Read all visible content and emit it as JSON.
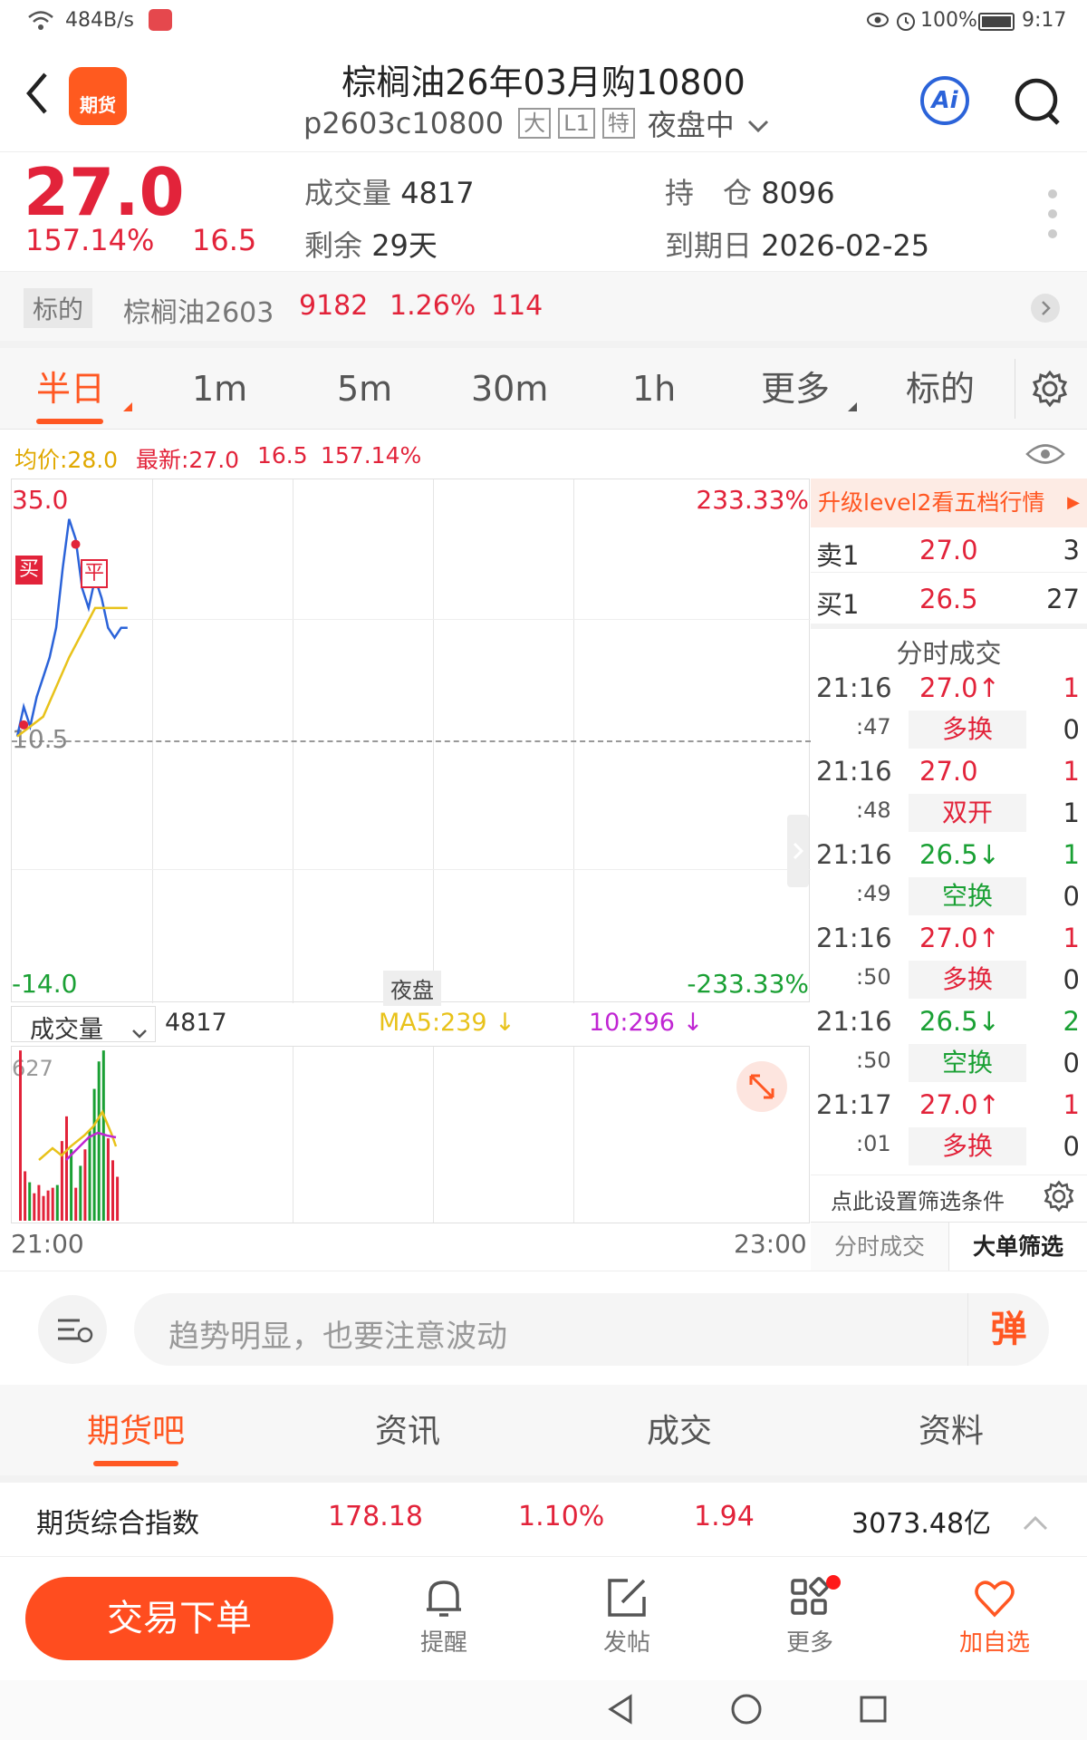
{
  "status_bar": {
    "net_speed": "484B/s",
    "battery": "100%",
    "time": "9:17"
  },
  "header": {
    "logo_text": "期货",
    "title": "棕榈油26年03月购10800",
    "code": "p2603c10800",
    "tags": [
      "大",
      "L1",
      "特"
    ],
    "session": "夜盘中",
    "ai_label": "Ai"
  },
  "summary": {
    "price": "27.0",
    "change_pct": "157.14%",
    "change": "16.5",
    "volume_label": "成交量",
    "volume": "4817",
    "remain_label": "剩余",
    "remain": "29天",
    "oi_label": "持　仓",
    "oi": "8096",
    "expiry_label": "到期日",
    "expiry": "2026-02-25"
  },
  "underlying": {
    "tag": "标的",
    "name": "棕榈油2603",
    "price": "9182",
    "pct": "1.26%",
    "chg": "114"
  },
  "period_tabs": [
    "半日",
    "1m",
    "5m",
    "30m",
    "1h",
    "更多",
    "标的"
  ],
  "info_line": {
    "avg": "均价:28.0",
    "latest": "最新:27.0",
    "chg": "16.5",
    "pct": "157.14%"
  },
  "chart": {
    "y_max": "35.0",
    "y_mid": "10.5",
    "y_min": "-14.0",
    "pct_max": "233.33%",
    "pct_min": "-233.33%",
    "session_label": "夜盘",
    "marker_buy": "买",
    "marker_close": "平",
    "vol_selector": "成交量",
    "vol_value": "4817",
    "ma5": "MA5:239",
    "ma10": "10:296",
    "vol_max": "627",
    "time_start": "21:00",
    "time_end": "23:00"
  },
  "chart_data": {
    "type": "line",
    "series": [
      {
        "name": "最新",
        "x": [
          "21:00",
          "21:01",
          "21:02",
          "21:03",
          "21:04",
          "21:05",
          "21:06",
          "21:07",
          "21:08",
          "21:09",
          "21:10",
          "21:11",
          "21:12",
          "21:13",
          "21:14",
          "21:15",
          "21:16",
          "21:17"
        ],
        "values": [
          11,
          14,
          12,
          15,
          17,
          19,
          22,
          28,
          33,
          31,
          26,
          24,
          27,
          25,
          22,
          21,
          22,
          22
        ]
      },
      {
        "name": "均价",
        "x": [
          "21:00",
          "21:04",
          "21:08",
          "21:12",
          "21:17"
        ],
        "values": [
          11,
          13,
          19,
          24,
          24
        ]
      }
    ],
    "ylim": [
      -14.0,
      35.0
    ]
  },
  "order_book": {
    "upgrade_label": "升级level2看五档行情",
    "ask_label": "卖1",
    "ask_price": "27.0",
    "ask_qty": "3",
    "bid_label": "买1",
    "bid_price": "26.5",
    "bid_qty": "27",
    "ticks_title": "分时成交",
    "ticks": [
      {
        "time": "21:16",
        "sec": ":47",
        "price": "27.0↑",
        "qty": "1",
        "type": "多换",
        "type_qty": "0",
        "dir": "up"
      },
      {
        "time": "21:16",
        "sec": ":48",
        "price": "27.0",
        "qty": "1",
        "type": "双开",
        "type_qty": "1",
        "dir": "flat"
      },
      {
        "time": "21:16",
        "sec": ":49",
        "price": "26.5↓",
        "qty": "1",
        "type": "空换",
        "type_qty": "0",
        "dir": "down"
      },
      {
        "time": "21:16",
        "sec": ":50",
        "price": "27.0↑",
        "qty": "1",
        "type": "多换",
        "type_qty": "0",
        "dir": "up"
      },
      {
        "time": "21:16",
        "sec": ":50",
        "price": "26.5↓",
        "qty": "2",
        "type": "空换",
        "type_qty": "0",
        "dir": "down"
      },
      {
        "time": "21:17",
        "sec": ":01",
        "price": "27.0↑",
        "qty": "1",
        "type": "多换",
        "type_qty": "0",
        "dir": "up"
      }
    ],
    "filter_label": "点此设置筛选条件",
    "tab_ticks": "分时成交",
    "tab_big": "大单筛选"
  },
  "comment": {
    "placeholder": "趋势明显，也要注意波动",
    "danmaku": "弹"
  },
  "bottom_tabs": [
    "期货吧",
    "资讯",
    "成交",
    "资料"
  ],
  "index_row": {
    "name": "期货综合指数",
    "value": "178.18",
    "pct": "1.10%",
    "chg": "1.94",
    "amount": "3073.48亿"
  },
  "actions": {
    "trade": "交易下单",
    "alert": "提醒",
    "post": "发帖",
    "more": "更多",
    "watch": "加自选"
  },
  "colors": {
    "accent": "#ff5722",
    "red": "#e2233a",
    "green": "#1aa034",
    "blue": "#2b63d9"
  }
}
